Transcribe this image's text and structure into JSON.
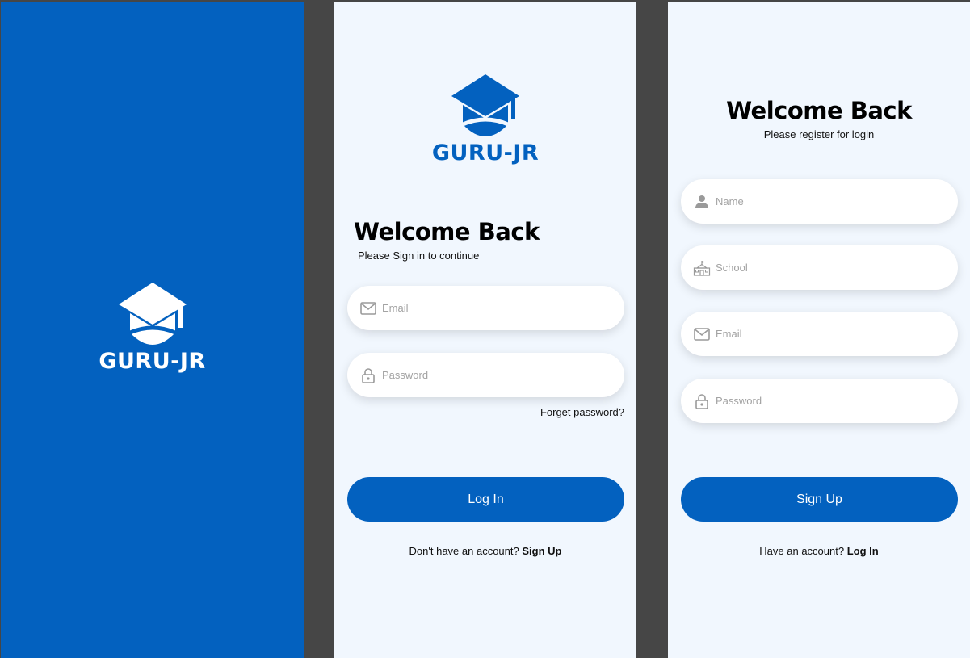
{
  "colors": {
    "brand_blue": "#0361bf",
    "screen_bg": "#f1f7fe",
    "canvas_bg": "#464646",
    "field_bg": "#ffffff",
    "placeholder": "#a3a3a3"
  },
  "splash": {
    "logo_icon": "graduation-cap-icon",
    "brand": "GURU-JR"
  },
  "login": {
    "logo_icon": "graduation-cap-icon",
    "brand": "GURU-JR",
    "title": "Welcome Back",
    "subtitle": "Please Sign in to continue",
    "email": {
      "icon": "mail-icon",
      "placeholder": "Email",
      "value": ""
    },
    "password": {
      "icon": "lock-icon",
      "placeholder": "Password",
      "value": ""
    },
    "forgot_label": "Forget password?",
    "button_label": "Log In",
    "footer_prompt": "Don't have an account? ",
    "footer_link": "Sign Up"
  },
  "signup": {
    "title": "Welcome Back",
    "subtitle": "Please register for login",
    "name": {
      "icon": "user-icon",
      "placeholder": "Name",
      "value": ""
    },
    "school": {
      "icon": "school-icon",
      "placeholder": "School",
      "value": ""
    },
    "email": {
      "icon": "mail-icon",
      "placeholder": "Email",
      "value": ""
    },
    "password": {
      "icon": "lock-icon",
      "placeholder": "Password",
      "value": ""
    },
    "button_label": "Sign Up",
    "footer_prompt": "Have an account? ",
    "footer_link": "Log In"
  }
}
